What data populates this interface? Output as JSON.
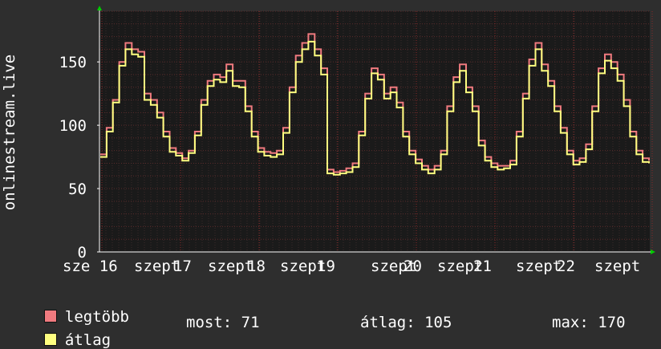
{
  "chart_data": {
    "type": "line",
    "ylabel": "onlinestream.live",
    "ylim": [
      0,
      190
    ],
    "y_ticks": [
      0,
      50,
      100,
      150
    ],
    "x_ticks": [
      "sze 16",
      "szept",
      "17",
      "szept",
      "18",
      "szept",
      "19",
      "szept",
      "20",
      "szept",
      "21",
      "szept",
      "22",
      "szept"
    ],
    "colors": {
      "background": "#2e2e2e",
      "plot_bg": "#1a1a1a",
      "grid": "#5a2a2a",
      "max": "#f07a7f",
      "avg": "#ffff80"
    },
    "series": [
      {
        "name": "legtöbb",
        "values": [
          77,
          98,
          120,
          150,
          165,
          160,
          158,
          125,
          120,
          110,
          95,
          82,
          78,
          74,
          80,
          95,
          120,
          135,
          140,
          138,
          148,
          135,
          135,
          115,
          95,
          82,
          79,
          78,
          80,
          98,
          130,
          155,
          165,
          172,
          160,
          145,
          65,
          63,
          64,
          66,
          70,
          95,
          125,
          145,
          140,
          125,
          130,
          118,
          95,
          80,
          73,
          68,
          65,
          68,
          80,
          115,
          138,
          148,
          130,
          115,
          88,
          75,
          70,
          68,
          68,
          72,
          95,
          125,
          152,
          165,
          148,
          135,
          115,
          98,
          80,
          72,
          74,
          85,
          115,
          145,
          156,
          150,
          140,
          120,
          95,
          80,
          74,
          72
        ]
      },
      {
        "name": "átlag",
        "values": [
          75,
          95,
          118,
          147,
          160,
          156,
          154,
          120,
          116,
          106,
          91,
          79,
          76,
          72,
          78,
          92,
          116,
          131,
          136,
          134,
          143,
          131,
          130,
          111,
          91,
          79,
          76,
          75,
          77,
          94,
          126,
          150,
          160,
          166,
          155,
          140,
          62,
          61,
          62,
          63,
          67,
          92,
          121,
          141,
          136,
          121,
          126,
          114,
          91,
          77,
          70,
          65,
          62,
          65,
          77,
          111,
          134,
          143,
          126,
          111,
          84,
          72,
          67,
          65,
          66,
          69,
          91,
          121,
          147,
          160,
          143,
          131,
          111,
          94,
          77,
          69,
          71,
          81,
          111,
          141,
          151,
          145,
          135,
          115,
          91,
          77,
          71,
          70
        ]
      }
    ]
  },
  "legend": {
    "max_label": "legtöbb",
    "avg_label": "átlag",
    "now_text": "most: 71",
    "avg_text": "átlag: 105",
    "max_text": "max: 170"
  }
}
